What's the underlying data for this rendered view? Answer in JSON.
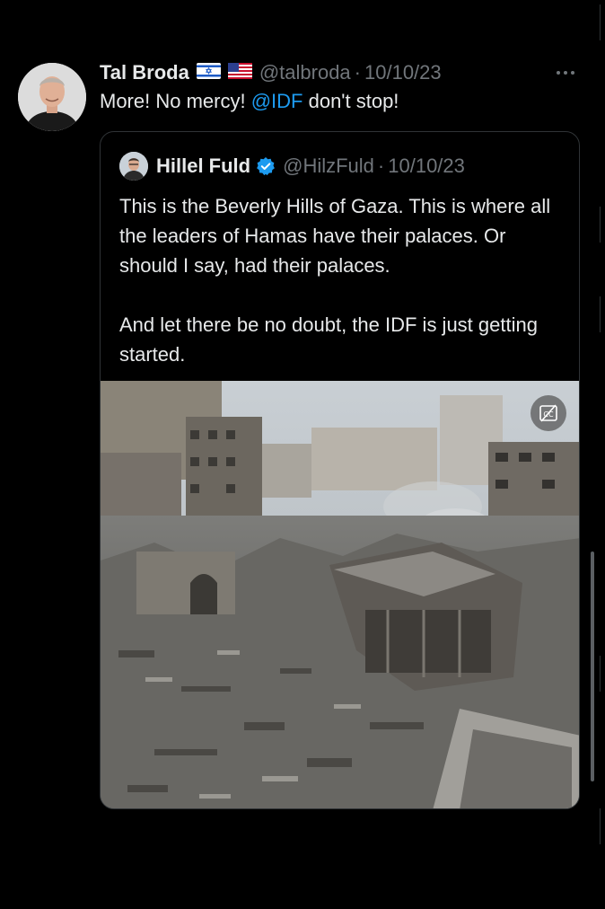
{
  "tweet": {
    "author_name": "Tal Broda",
    "flag_1": "Israel flag",
    "flag_2": "USA flag",
    "handle": "@talbroda",
    "separator": "·",
    "date": "10/10/23",
    "text_before": "More! No mercy! ",
    "mention": "@IDF",
    "text_after": " don't stop!",
    "more_icon": "more-horizontal-icon"
  },
  "quote": {
    "author_name": "Hillel Fuld",
    "verified_icon": "verified-badge-icon",
    "handle": "@HilzFuld",
    "separator": "·",
    "date": "10/10/23",
    "paragraph_1": "This is the Beverly Hills of Gaza. This is where all the leaders of Hamas have their palaces. Or should I say, had their palaces.",
    "paragraph_2": "And let there be no doubt, the IDF is just getting started.",
    "media_icon": "caption-toggle-icon"
  },
  "colors": {
    "background": "#000000",
    "primary_text": "#e7e9ea",
    "secondary_text": "#71767b",
    "link": "#1d9bf0",
    "border": "#2f3336",
    "verified": "#1d9bf0"
  }
}
